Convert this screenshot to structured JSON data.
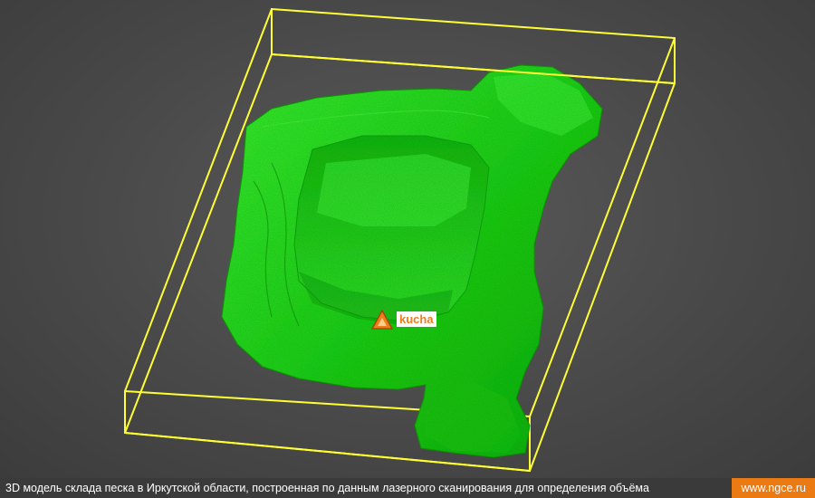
{
  "scene": {
    "marker": {
      "label": "kucha",
      "icon": "warning-triangle-icon",
      "color": "#f07c1a"
    },
    "colors": {
      "mesh": "#22e01c",
      "bounding_box": "#ffff33",
      "background": "#4a4a4a"
    }
  },
  "footer": {
    "caption": "3D модель склада песка в Иркутской области, построенная по данным лазерного сканирования для определения объёма",
    "site": "www.ngce.ru"
  }
}
